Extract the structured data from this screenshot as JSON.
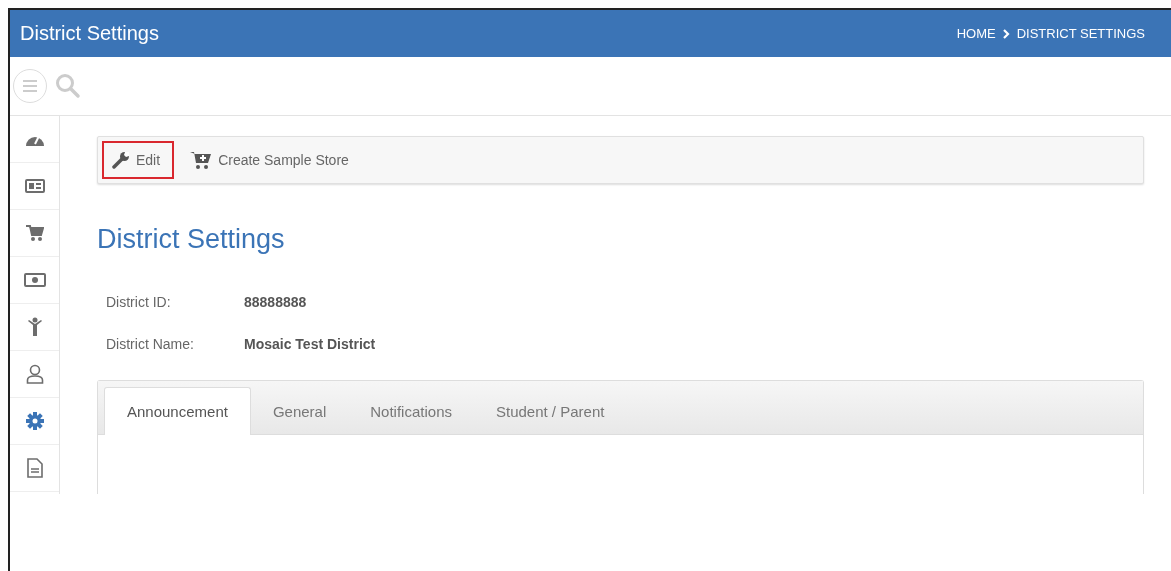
{
  "header": {
    "title": "District Settings",
    "breadcrumb": [
      "HOME",
      "DISTRICT SETTINGS"
    ]
  },
  "sidebar": {
    "items": [
      {
        "kind": "dashboard",
        "selected": false
      },
      {
        "kind": "card",
        "selected": false
      },
      {
        "kind": "cart",
        "selected": false
      },
      {
        "kind": "money",
        "selected": false
      },
      {
        "kind": "child",
        "selected": false
      },
      {
        "kind": "user",
        "selected": false
      },
      {
        "kind": "gear",
        "selected": true
      },
      {
        "kind": "document",
        "selected": false
      }
    ]
  },
  "toolbar": [
    {
      "kind": "edit",
      "label": "Edit",
      "highlighted": true
    },
    {
      "kind": "store",
      "label": "Create Sample Store",
      "highlighted": false
    }
  ],
  "page_title": "District Settings",
  "fields": [
    {
      "label": "District ID:",
      "value": "88888888"
    },
    {
      "label": "District Name:",
      "value": "Mosaic Test District"
    }
  ],
  "tabs": [
    {
      "label": "Announcement",
      "selected": true
    },
    {
      "label": "General",
      "selected": false
    },
    {
      "label": "Notifications",
      "selected": false
    },
    {
      "label": "Student / Parent",
      "selected": false
    }
  ]
}
